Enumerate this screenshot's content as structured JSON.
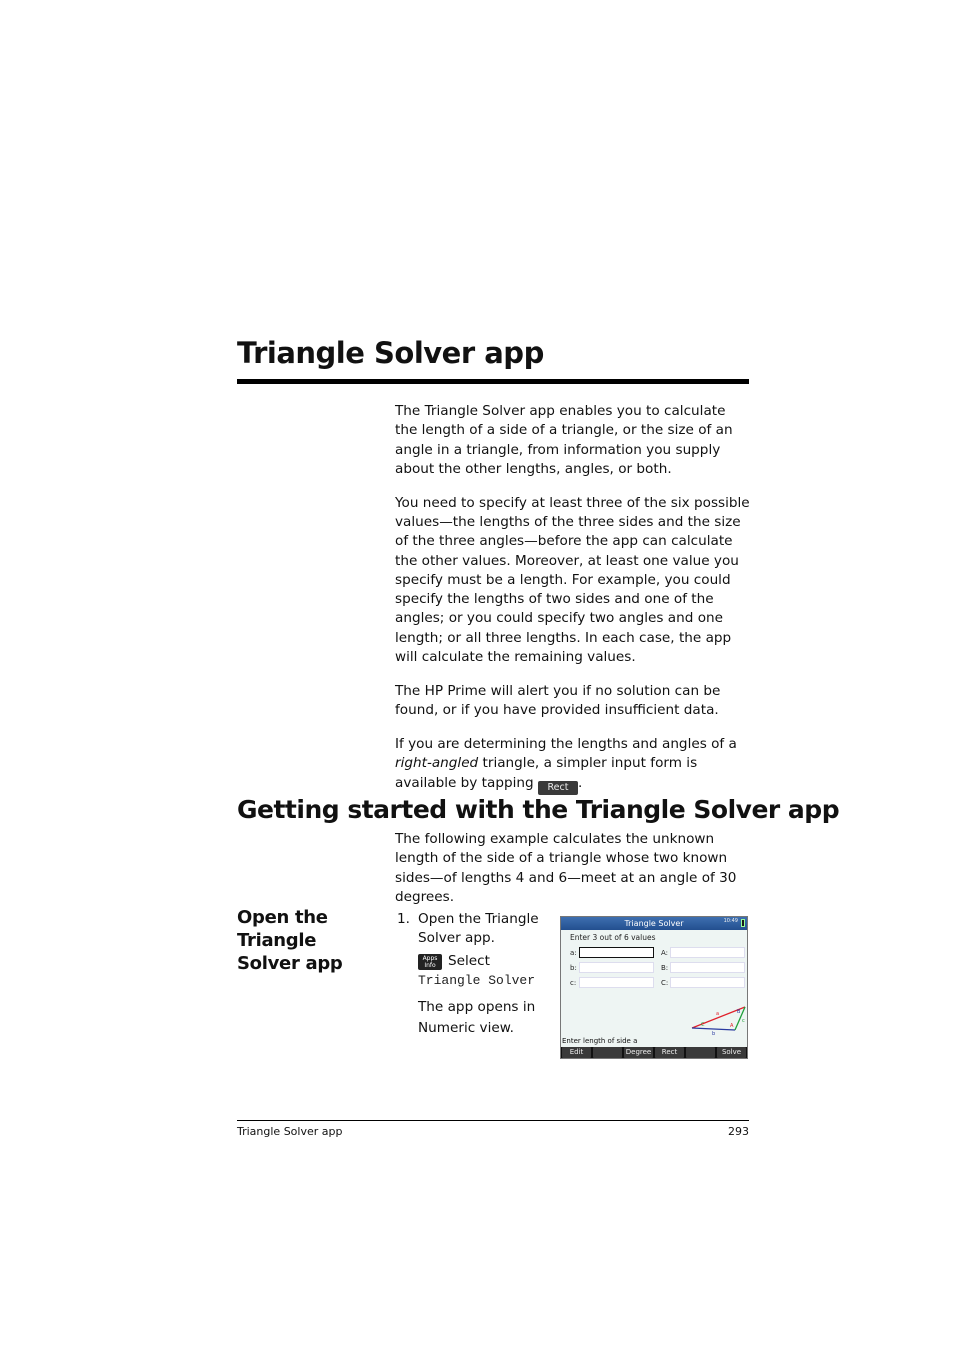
{
  "section_title": "Triangle Solver app",
  "intro": {
    "p1": "The Triangle Solver app enables you to calculate the length of a side of a triangle, or the size of an angle in a triangle, from information you supply about the other lengths, angles, or both.",
    "p2": "You need to specify at least three of the six possible values—the lengths of the three sides and the size of the three angles—before the app can calculate the other values. Moreover, at least one value you specify must be a length. For example, you could specify the lengths of two sides and one of the angles; or you could specify two angles and one length; or all three lengths. In each case, the app will calculate the remaining values.",
    "p3": "The HP Prime will alert you if no solution can be found, or if you have provided insufficient data.",
    "p4_before": "If you are determining the lengths and angles of a ",
    "p4_italic": "right-angled",
    "p4_after": " triangle, a simpler input form is available by tapping ",
    "p4_key": "Rect",
    "p4_end": "."
  },
  "getting_started": {
    "heading": "Getting started with the Triangle Solver app",
    "text": "The following example calculates the unknown length of the side of a triangle whose two known sides—of lengths 4 and 6—meet at an angle of 30 degrees."
  },
  "open_app": {
    "heading": "Open the Triangle Solver app",
    "step_number": "1.",
    "step_text": "Open the Triangle Solver app.",
    "key_label_top": "Apps",
    "key_label_bottom": "Info",
    "select_label": "Select",
    "app_name": "Triangle Solver",
    "result_text": "The app opens in Numeric view."
  },
  "calculator": {
    "title": "Triangle Solver",
    "time": "10:49",
    "prompt": "Enter 3 out of 6 values",
    "fields": [
      {
        "label": "a:",
        "value": ""
      },
      {
        "label": "b:",
        "value": ""
      },
      {
        "label": "c:",
        "value": ""
      },
      {
        "label": "A:",
        "value": ""
      },
      {
        "label": "B:",
        "value": ""
      },
      {
        "label": "C:",
        "value": ""
      }
    ],
    "diagram_labels": {
      "side_a": "a",
      "side_b": "b",
      "side_c": "c",
      "angle_A": "A",
      "angle_B": "B",
      "angle_C": "C"
    },
    "colors": {
      "side_a": "#e0202a",
      "side_b": "#2a3aa0",
      "side_c": "#1fa03a"
    },
    "status": "Enter length of side a",
    "menu": [
      "Edit",
      "",
      "Degree",
      "Rect",
      "",
      "Solve"
    ]
  },
  "footer": {
    "left": "Triangle Solver app",
    "page": "293"
  }
}
